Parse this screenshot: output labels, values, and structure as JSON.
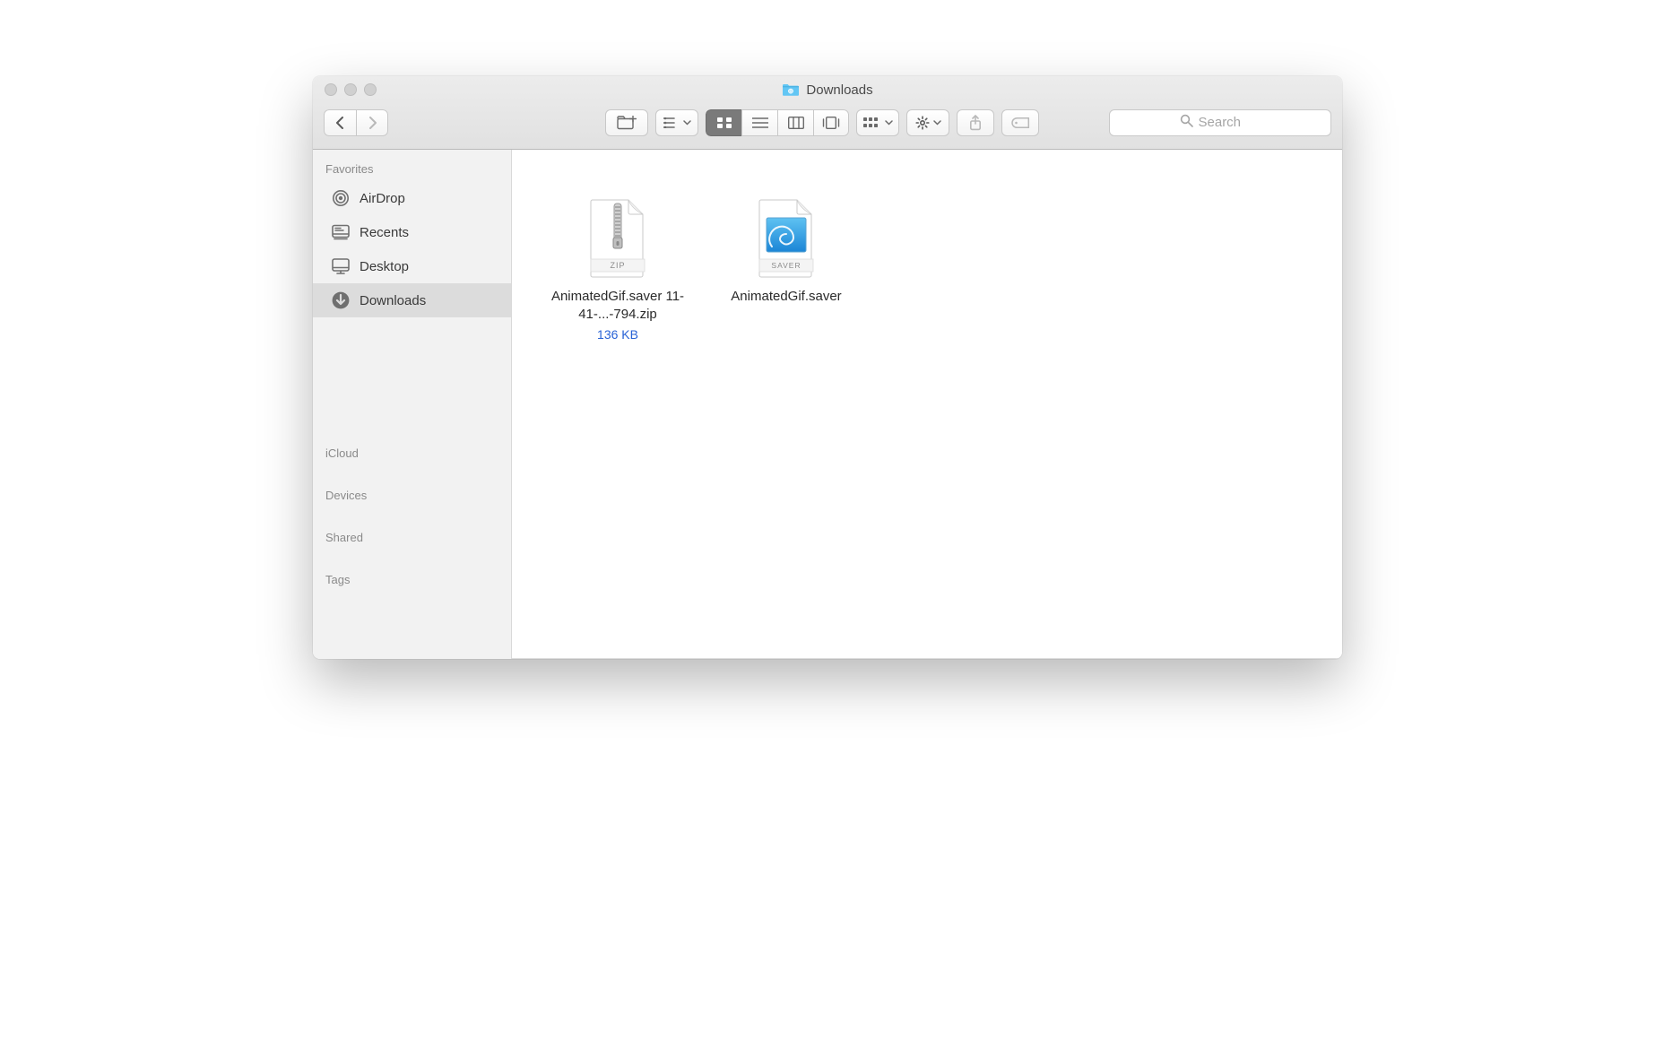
{
  "window": {
    "title": "Downloads"
  },
  "search": {
    "placeholder": "Search"
  },
  "sidebar": {
    "sections": {
      "favorites": "Favorites",
      "icloud": "iCloud",
      "devices": "Devices",
      "shared": "Shared",
      "tags": "Tags"
    },
    "items": [
      {
        "label": "AirDrop",
        "icon": "airdrop-icon",
        "selected": false
      },
      {
        "label": "Recents",
        "icon": "recents-icon",
        "selected": false
      },
      {
        "label": "Desktop",
        "icon": "desktop-icon",
        "selected": false
      },
      {
        "label": "Downloads",
        "icon": "downloads-icon",
        "selected": true
      }
    ]
  },
  "files": [
    {
      "name": "AnimatedGif.saver 11-41-...-794.zip",
      "type": "zip",
      "badge": "ZIP",
      "size": "136 KB"
    },
    {
      "name": "AnimatedGif.saver",
      "type": "saver",
      "badge": "SAVER",
      "size": ""
    }
  ]
}
